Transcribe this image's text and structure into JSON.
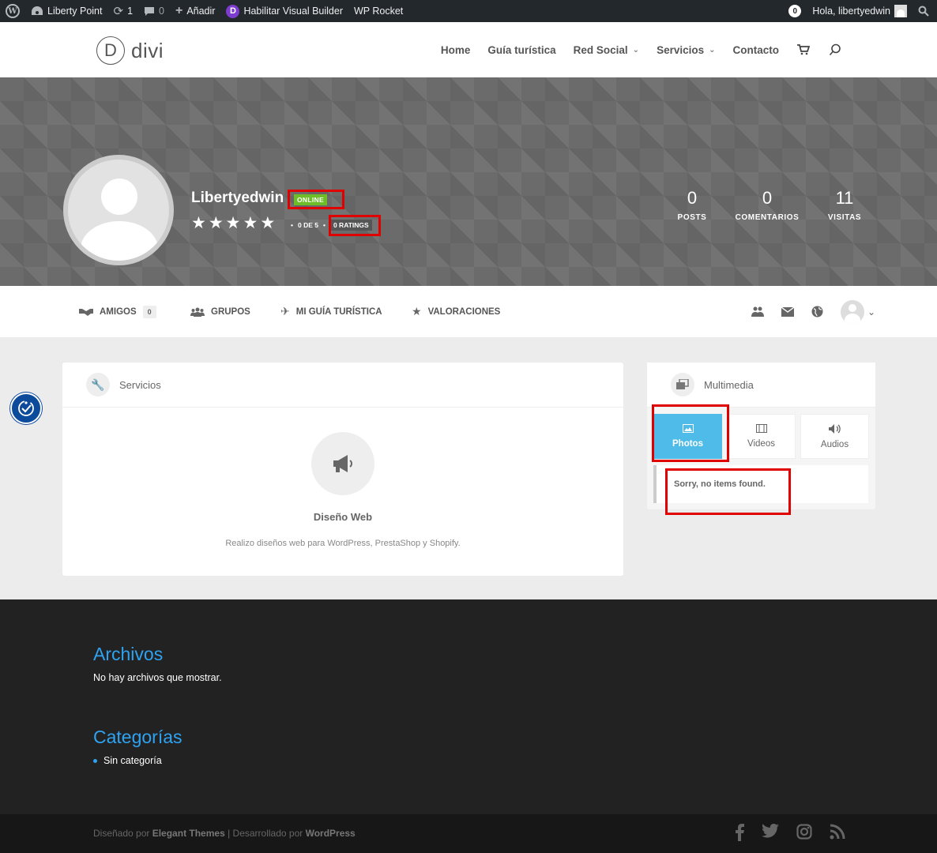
{
  "admin_bar": {
    "site": "Liberty Point",
    "updates": "1",
    "comments": "0",
    "add_new": "Añadir",
    "visual_builder": "Habilitar Visual Builder",
    "wp_rocket": "WP Rocket",
    "notifications": "0",
    "greeting": "Hola, libertyedwin"
  },
  "header": {
    "logo_letter": "D",
    "logo_text": "divi",
    "nav": [
      "Home",
      "Guía turística",
      "Red Social",
      "Servicios",
      "Contacto"
    ]
  },
  "profile": {
    "name": "Libertyedwin",
    "status": "ONLINE",
    "rating": 5,
    "rating_text": "0 DE 5",
    "ratings_count": "0 RATINGS",
    "stats": [
      {
        "value": "0",
        "label": "POSTS"
      },
      {
        "value": "0",
        "label": "COMENTARIOS"
      },
      {
        "value": "11",
        "label": "VISITAS"
      }
    ]
  },
  "profile_nav": {
    "friends": "AMIGOS",
    "friends_count": "0",
    "groups": "GRUPOS",
    "guide": "MI GUÍA TURÍSTICA",
    "ratings": "VALORACIONES"
  },
  "services": {
    "title": "Servicios",
    "item_title": "Diseño Web",
    "item_desc": "Realizo diseños web para WordPress, PrestaShop y Shopify."
  },
  "multimedia": {
    "title": "Multimedia",
    "tabs": [
      "Photos",
      "Videos",
      "Audios"
    ],
    "empty": "Sorry, no items found."
  },
  "footer": {
    "archives_title": "Archivos",
    "archives_text": "No hay archivos que mostrar.",
    "categories_title": "Categorías",
    "category_item": "Sin categoría",
    "credit_prefix": "Diseñado por ",
    "credit_theme": "Elegant Themes",
    "credit_mid": " | Desarrollado por ",
    "credit_wp": "WordPress"
  },
  "colors": {
    "accent": "#2ea3f2",
    "online": "#6ebd28",
    "tab_active": "#4fbbe8",
    "highlight": "#e00000"
  }
}
